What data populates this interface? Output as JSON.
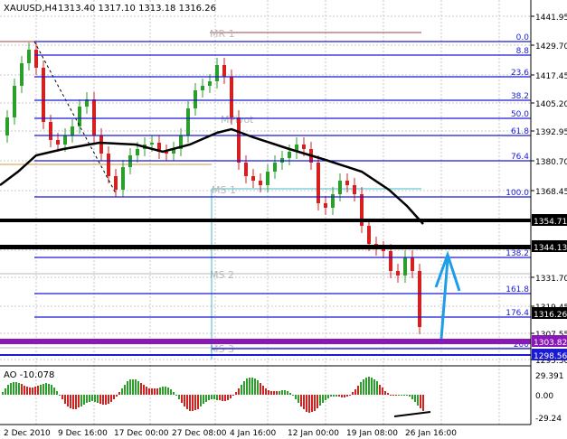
{
  "header": {
    "symbol": "XAUUSD,H4",
    "ohlc": "1313.40 1317.10 1313.18 1316.26"
  },
  "colors": {
    "background": "#ffffff",
    "grid": "#c8c8c8",
    "fib_line": "#1a1ad4",
    "pivot": "#b8b8b8",
    "sr_line": "#000000",
    "support_line": "#8a18b8",
    "ma_line": "#000000",
    "bull": "#2aa02a",
    "bear": "#d62020",
    "arrow": "#1e9ee8",
    "price_tag_bg": "#000000",
    "price_tag_fg": "#ffffff"
  },
  "price_axis": [
    "1441.95",
    "1429.70",
    "1417.45",
    "1405.20",
    "1392.95",
    "1380.70",
    "1368.45",
    "1331.70",
    "1319.45",
    "1307.55",
    "1295.30"
  ],
  "price_tags": [
    {
      "label": "1354.71",
      "style": "black"
    },
    {
      "label": "1344.13",
      "style": "black"
    },
    {
      "label": "1316.26",
      "style": "black"
    },
    {
      "label": "1303.82",
      "style": "purple"
    },
    {
      "label": "1298.56",
      "style": "blue"
    }
  ],
  "fib_levels": [
    "0.0",
    "8.8",
    "23.6",
    "38.2",
    "50.0",
    "61.8",
    "76.4",
    "100.0",
    "138.2",
    "161.8",
    "176.4",
    "200"
  ],
  "pivots": [
    "MR 1",
    "MPivot",
    "MS 1",
    "MS 2",
    "MS 3"
  ],
  "ao": {
    "label": "AO -10.078",
    "scale": [
      "29.391",
      "0.00",
      "-29.24"
    ]
  },
  "time_axis": [
    "2 Dec 2010",
    "9 Dec 16:00",
    "17 Dec 00:00",
    "27 Dec 08:00",
    "4 Jan 16:00",
    "12 Jan 00:00",
    "19 Jan 08:00",
    "26 Jan 16:00"
  ]
}
